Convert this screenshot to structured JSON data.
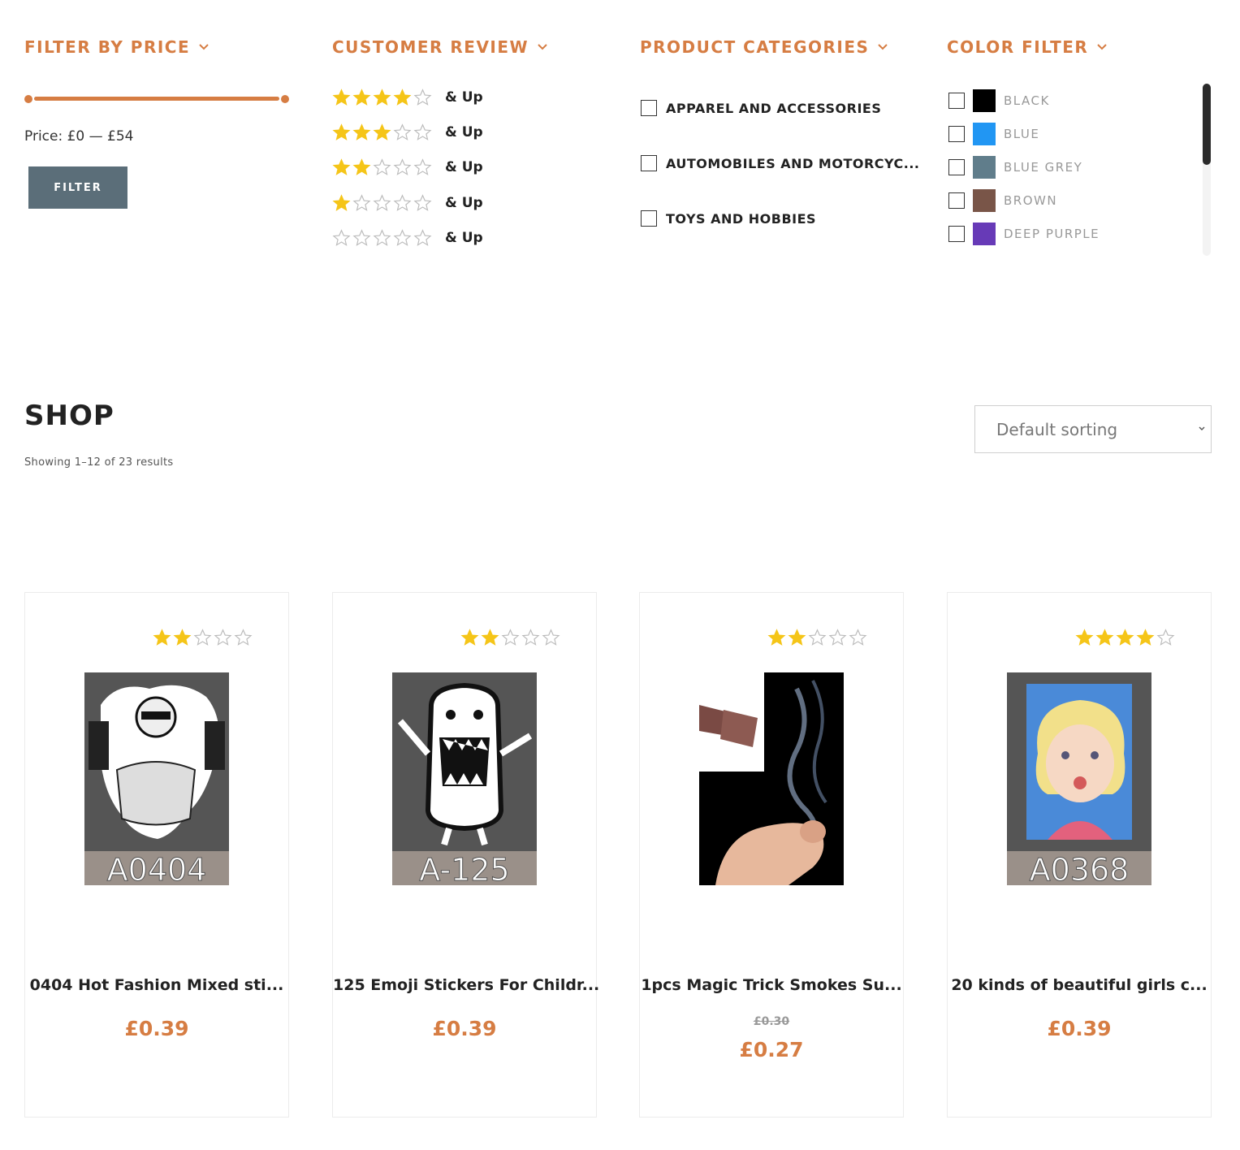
{
  "filters": {
    "price": {
      "title": "FILTER BY PRICE",
      "range_text": "Price: £0 — £54",
      "button_label": "FILTER"
    },
    "review": {
      "title": "CUSTOMER REVIEW",
      "rows": [
        {
          "rating": 4,
          "label": "& Up"
        },
        {
          "rating": 3,
          "label": "& Up"
        },
        {
          "rating": 2,
          "label": "& Up"
        },
        {
          "rating": 1,
          "label": "& Up"
        },
        {
          "rating": 0,
          "label": "& Up"
        }
      ]
    },
    "categories": {
      "title": "PRODUCT CATEGORIES",
      "items": [
        {
          "label": "APPAREL AND ACCESSORIES"
        },
        {
          "label": "AUTOMOBILES AND MOTORCYC..."
        },
        {
          "label": "TOYS AND HOBBIES"
        }
      ]
    },
    "colors": {
      "title": "COLOR FILTER",
      "items": [
        {
          "label": "BLACK",
          "color": "#000000"
        },
        {
          "label": "BLUE",
          "color": "#2196f3"
        },
        {
          "label": "BLUE GREY",
          "color": "#607d8b"
        },
        {
          "label": "BROWN",
          "color": "#795548"
        },
        {
          "label": "DEEP PURPLE",
          "color": "#673ab7"
        }
      ]
    }
  },
  "shop": {
    "title": "SHOP",
    "result_count": "Showing 1–12 of 23 results",
    "sort_value": "Default sorting"
  },
  "products": [
    {
      "name": "0404 Hot Fashion Mixed sti...",
      "price": "£0.39",
      "rating": 2,
      "image_code": "A0404"
    },
    {
      "name": "125 Emoji Stickers For Childr...",
      "price": "£0.39",
      "rating": 2,
      "image_code": "A-125"
    },
    {
      "name": "1pcs Magic Trick Smokes Su...",
      "old_price": "£0.30",
      "price": "£0.27",
      "rating": 2,
      "image_code": ""
    },
    {
      "name": "20 kinds of beautiful girls c...",
      "price": "£0.39",
      "rating": 4,
      "image_code": "A0368"
    }
  ],
  "colors": {
    "accent": "#d67d43",
    "star": "#f5c518",
    "button": "#5b6e79"
  }
}
